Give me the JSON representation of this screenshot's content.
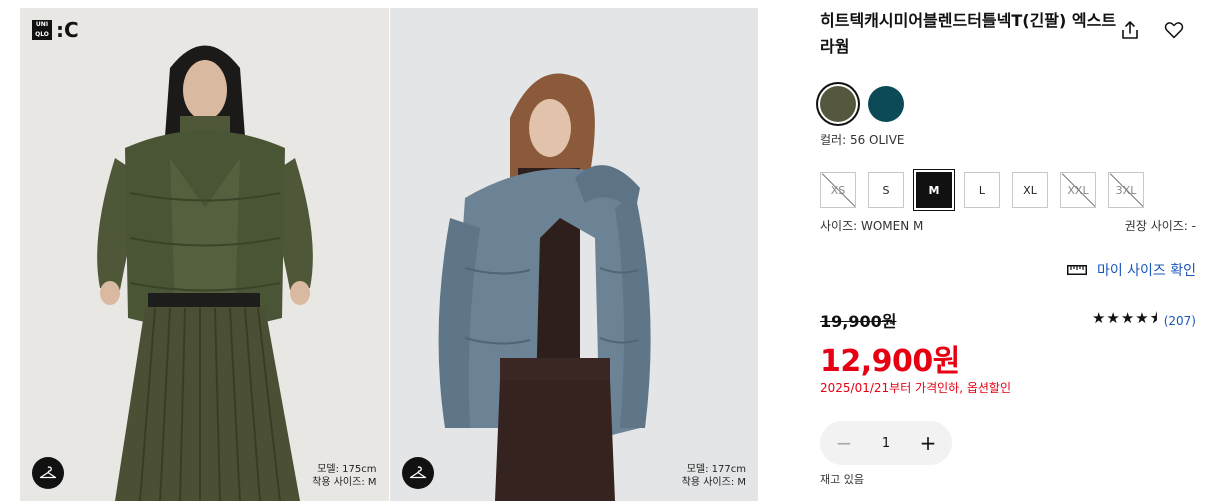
{
  "brand": {
    "logo_small": [
      "UNI",
      "QLO"
    ],
    "logo_suffix": ":C"
  },
  "gallery": [
    {
      "model_height": "모델: 175cm",
      "model_size": "착용 사이즈: M"
    },
    {
      "model_height": "모델: 177cm",
      "model_size": "착용 사이즈: M"
    }
  ],
  "product": {
    "title": "히트텍캐시미어블렌드터틀넥T(긴팔) 엑스트라웜",
    "colors": [
      {
        "code": "56",
        "hex": "#55583d",
        "selected": true
      },
      {
        "code": "",
        "hex": "#0c4a57",
        "selected": false
      }
    ],
    "color_label": "컬러: 56 OLIVE",
    "sizes": [
      {
        "label": "XS",
        "state": "soldout"
      },
      {
        "label": "S",
        "state": "available"
      },
      {
        "label": "M",
        "state": "selected"
      },
      {
        "label": "L",
        "state": "available"
      },
      {
        "label": "XL",
        "state": "available"
      },
      {
        "label": "XXL",
        "state": "soldout"
      },
      {
        "label": "3XL",
        "state": "soldout"
      }
    ],
    "size_label": "사이즈: WOMEN M",
    "recommended_size": "권장 사이즈: -",
    "my_size_link": "마이 사이즈 확인",
    "original_price": "19,900원",
    "sale_price": "12,900원",
    "rating_stars": "★★★★⯨",
    "rating_value": 4.5,
    "review_count": "(207)",
    "promo_text": "2025/01/21부터 가격인하, 옵션할인",
    "quantity": "1",
    "qty_minus": "−",
    "qty_plus": "+",
    "stock_status": "재고 있음"
  },
  "colors": {
    "sale_red": "#e60012",
    "link_blue": "#1a56b8"
  }
}
